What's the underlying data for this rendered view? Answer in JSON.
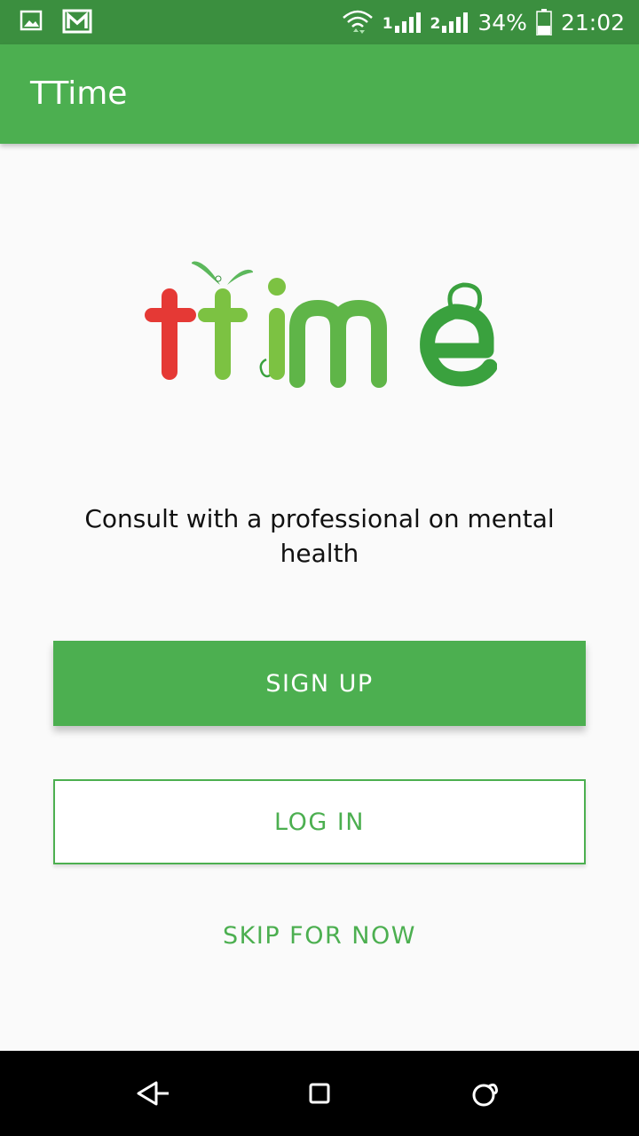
{
  "status_bar": {
    "battery": "34%",
    "time": "21:02",
    "sim1": "1",
    "sim2": "2",
    "icons": [
      "image-notification-icon",
      "gmail-icon",
      "wifi-icon",
      "signal-sim1-icon",
      "signal-sim2-icon",
      "battery-icon"
    ]
  },
  "app_bar": {
    "title": "TTime"
  },
  "logo": {
    "text": "ttime",
    "colors": {
      "first_t": "#e53935",
      "rest": "#7cc242",
      "accent": "#3aa13e"
    }
  },
  "main": {
    "tagline": "Consult with a professional on mental health",
    "signup_label": "SIGN UP",
    "login_label": "LOG IN",
    "skip_label": "SKIP FOR NOW"
  },
  "nav_bar": {
    "icons": [
      "back-icon",
      "home-icon",
      "recents-icon"
    ]
  },
  "colors": {
    "primary": "#4caf50",
    "primary_dark": "#3b8f3f",
    "background": "#fafafa"
  }
}
